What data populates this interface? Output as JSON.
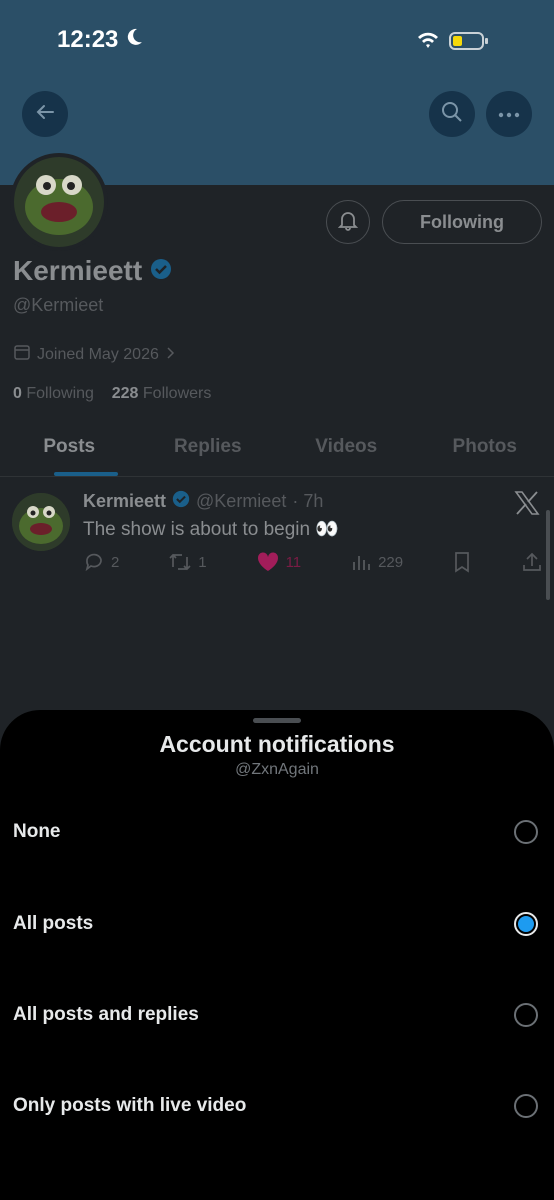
{
  "status_bar": {
    "time": "12:23"
  },
  "profile": {
    "name": "Kermieett",
    "handle": "@Kermieet",
    "joined": "Joined May 2026",
    "following_count": "0",
    "following_label": "Following",
    "followers_count": "228",
    "followers_label": "Followers",
    "follow_button": "Following"
  },
  "tabs": [
    "Posts",
    "Replies",
    "Videos",
    "Photos"
  ],
  "post": {
    "name": "Kermieett",
    "handle": "@Kermieet",
    "time": "· 7h",
    "text": "The show is about to begin 👀",
    "replies": "2",
    "reposts": "1",
    "likes": "11",
    "views": "229"
  },
  "sheet": {
    "title": "Account notifications",
    "subtitle": "@ZxnAgain",
    "options": [
      {
        "label": "None",
        "selected": false
      },
      {
        "label": "All posts",
        "selected": true
      },
      {
        "label": "All posts and replies",
        "selected": false
      },
      {
        "label": "Only posts with live video",
        "selected": false
      }
    ]
  },
  "colors": {
    "accent": "#1d9bf0",
    "like": "#f91880",
    "banner": "#2b4f67"
  }
}
